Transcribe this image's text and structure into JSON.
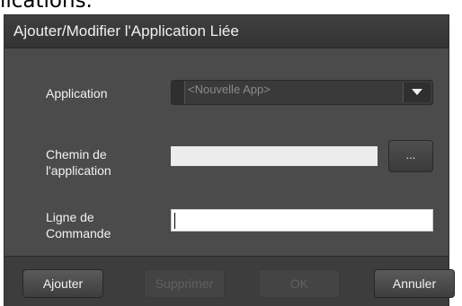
{
  "background_text": "lications.",
  "dialog": {
    "title": "Ajouter/Modifier l'Application Liée",
    "application_label": "Application",
    "application_select": {
      "selected": "<Nouvelle App>"
    },
    "path_label": "Chemin de\nl'application",
    "path_value": "",
    "browse_label": "...",
    "command_label": "Ligne de\nCommande",
    "command_value": ""
  },
  "footer": {
    "add_label": "Ajouter",
    "delete_label": "Supprimer",
    "ok_label": "OK",
    "cancel_label": "Annuler"
  },
  "colors": {
    "dialog_bg": "#4b4b4b",
    "titlebar_bg": "#3a3a3a",
    "footer_bg": "#3d3d3d",
    "text": "#f2f2f2",
    "disabled_text": "#606060"
  }
}
